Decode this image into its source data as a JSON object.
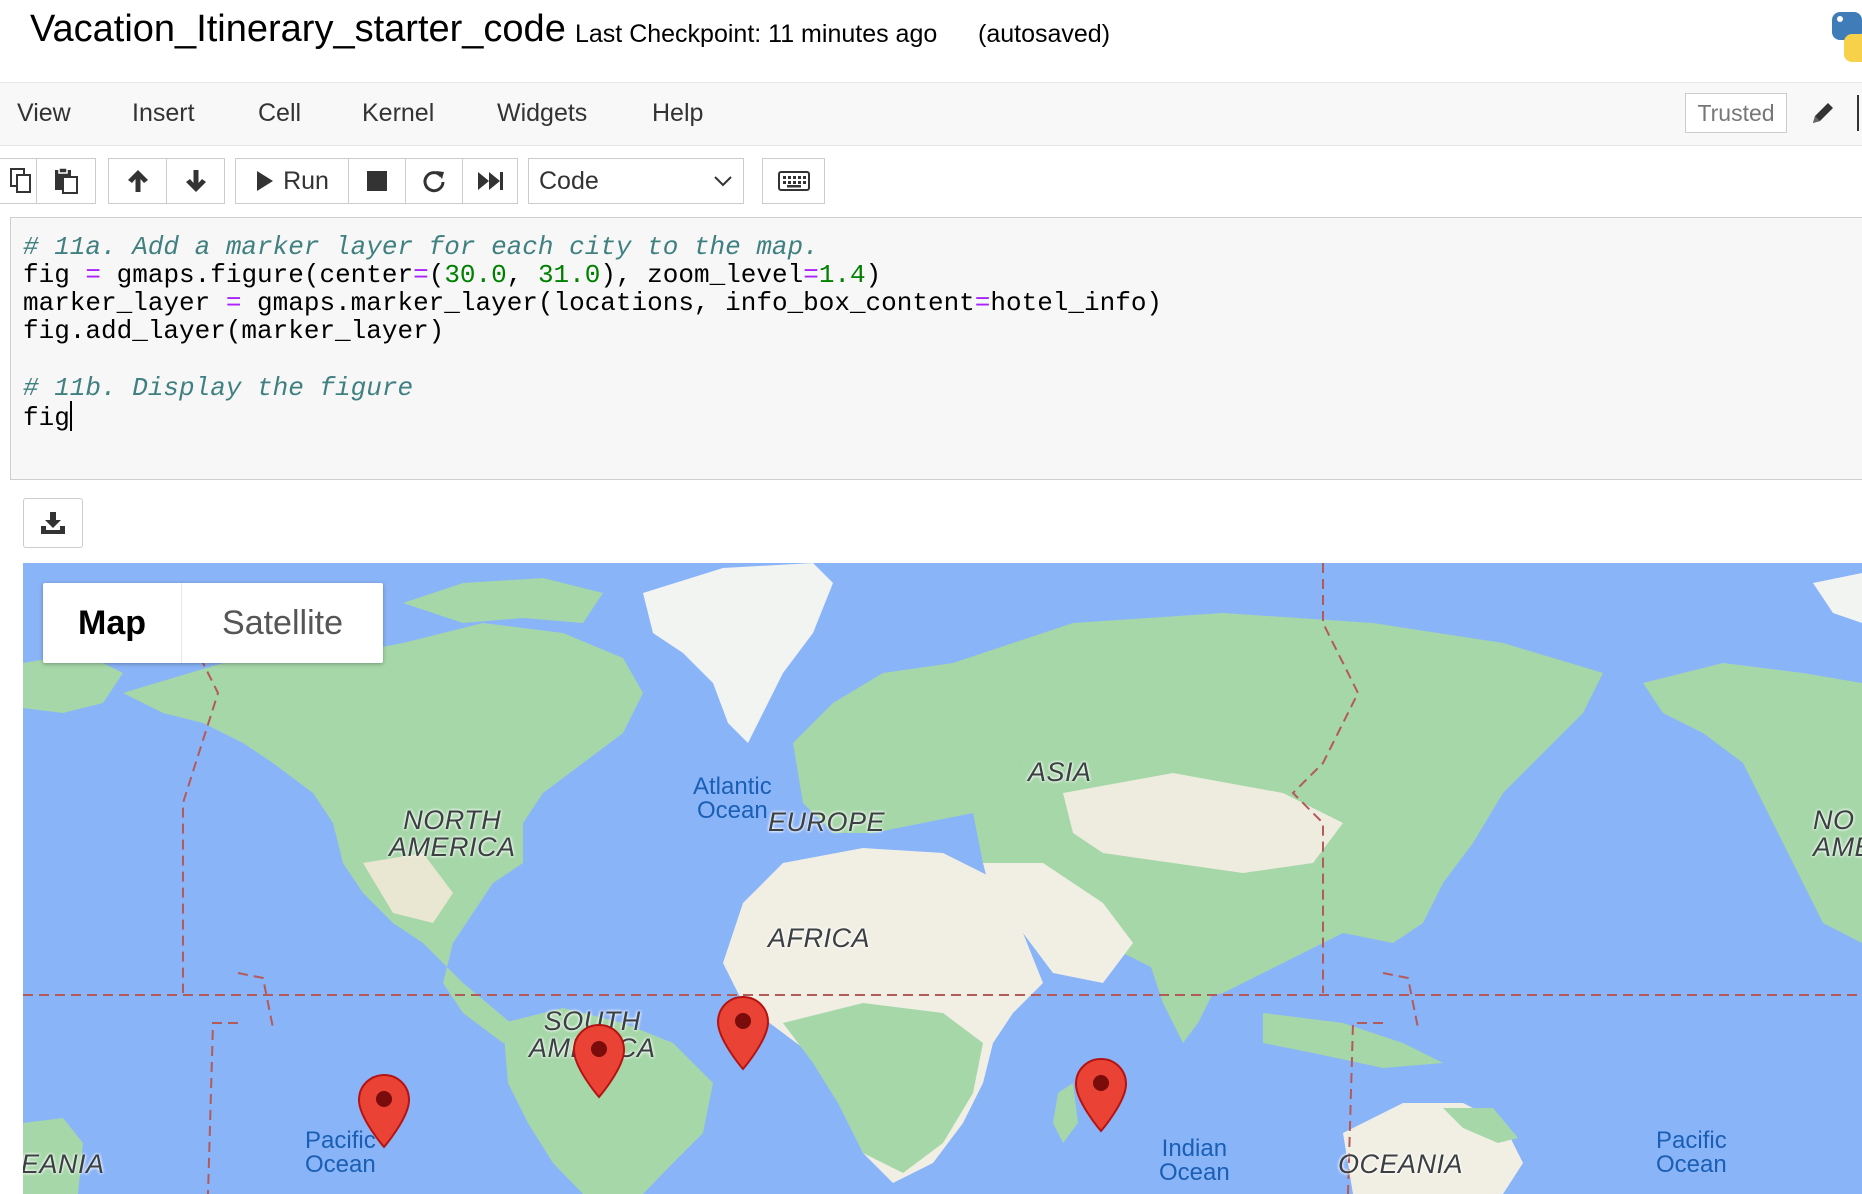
{
  "header": {
    "notebook_title": "Vacation_Itinerary_starter_code",
    "checkpoint": "Last Checkpoint: 11 minutes ago",
    "autosave_status": "(autosaved)"
  },
  "menubar": {
    "items": [
      "View",
      "Insert",
      "Cell",
      "Kernel",
      "Widgets",
      "Help"
    ],
    "trusted_label": "Trusted"
  },
  "toolbar": {
    "run_label": "Run",
    "cell_type": "Code"
  },
  "code_cell": {
    "lines": [
      "# 11a. Add a marker layer for each city to the map.",
      "fig = gmaps.figure(center=(30.0, 31.0), zoom_level=1.4)",
      "marker_layer = gmaps.marker_layer(locations, info_box_content=hotel_info)",
      "fig.add_layer(marker_layer)",
      "",
      "# 11b. Display the figure",
      "fig"
    ],
    "line1": {
      "comment": "# 11a. Add a marker layer for each city to the map."
    },
    "line2": {
      "a": "fig ",
      "b": "=",
      "c": " gmaps.figure(center",
      "d": "=",
      "e": "(",
      "f": "30.0",
      "g": ", ",
      "h": "31.0",
      "i": "), zoom_level",
      "j": "=",
      "k": "1.4",
      "l": ")"
    },
    "line3": {
      "a": "marker_layer ",
      "b": "=",
      "c": " gmaps.marker_layer(locations, info_box_content",
      "d": "=",
      "e": "hotel_info)"
    },
    "line4": "fig.add_layer(marker_layer)",
    "line6": {
      "comment": "# 11b. Display the figure"
    },
    "line7": "fig"
  },
  "map": {
    "map_type_options": [
      "Map",
      "Satellite"
    ],
    "selected_map_type": "Map",
    "continent_labels": {
      "north_america_1": "NORTH",
      "north_america_2": "AMERICA",
      "europe": "EUROPE",
      "asia": "ASIA",
      "africa": "AFRICA",
      "south_america_1": "SOUTH",
      "south_america_2": "AMERICA",
      "oceania_left": "EANIA",
      "oceania_right": "OCEANIA",
      "north_america_right_1": "NO",
      "north_america_right_2": "AME"
    },
    "ocean_labels": {
      "atlantic_1": "Atlantic",
      "atlantic_2": "Ocean",
      "pacific_left_1": "Pacific",
      "pacific_left_2": "Ocean",
      "indian_1": "Indian",
      "indian_2": "Ocean",
      "pacific_right_1": "Pacific",
      "pacific_right_2": "Ocean"
    },
    "marker_count": 4,
    "colors": {
      "water": "#8ab4f8",
      "land": "#a6d7a8",
      "desert": "#f1efe4",
      "marker": "#ea4335",
      "border": "#b35a5a"
    }
  }
}
